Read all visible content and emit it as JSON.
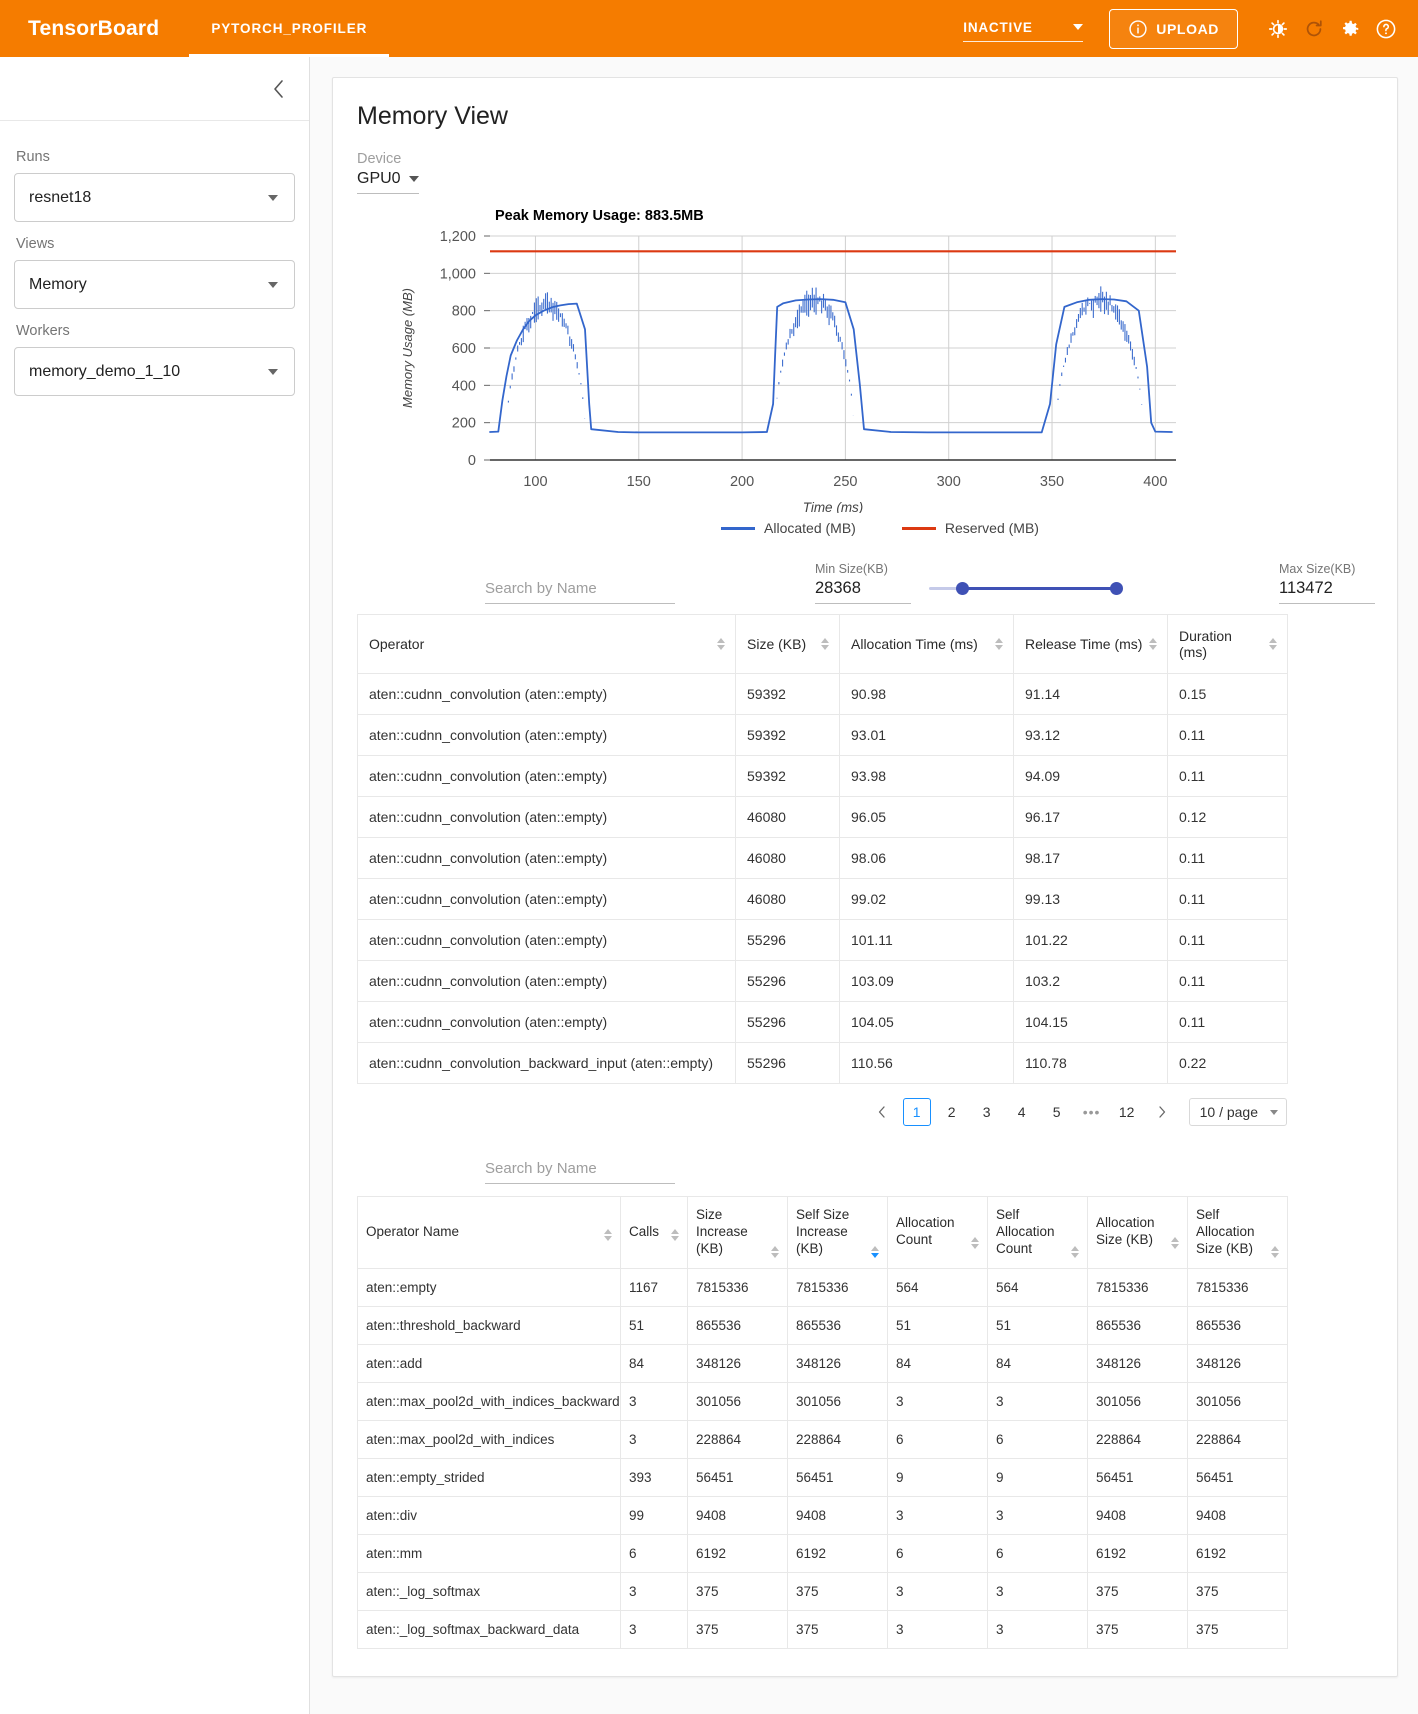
{
  "topbar": {
    "brand": "TensorBoard",
    "tab": "PYTORCH_PROFILER",
    "status_select": "INACTIVE",
    "upload_label": "UPLOAD",
    "icons": [
      "info-icon",
      "brightness-icon",
      "refresh-icon",
      "gear-icon",
      "help-icon"
    ],
    "accent": "#f57c00"
  },
  "sidebar": {
    "collapse_icon": "chevron-left-icon",
    "runs_label": "Runs",
    "runs_value": "resnet18",
    "views_label": "Views",
    "views_value": "Memory",
    "workers_label": "Workers",
    "workers_value": "memory_demo_1_10"
  },
  "main": {
    "title": "Memory View",
    "device_label": "Device",
    "device_value": "GPU0"
  },
  "chart_data": {
    "type": "line",
    "title": "Peak Memory Usage: 883.5MB",
    "xlabel": "Time (ms)",
    "ylabel": "Memory Usage (MB)",
    "xlim": [
      78,
      410
    ],
    "ylim": [
      0,
      1200
    ],
    "xticks": [
      100,
      150,
      200,
      250,
      300,
      350,
      400
    ],
    "yticks": [
      0,
      200,
      400,
      600,
      800,
      "1,000",
      "1,200"
    ],
    "grid": true,
    "legend_position": "bottom",
    "series": [
      {
        "name": "Allocated (MB)",
        "color": "#3366cc",
        "points": [
          [
            78,
            150
          ],
          [
            82,
            152
          ],
          [
            84,
            320
          ],
          [
            86,
            450
          ],
          [
            88,
            560
          ],
          [
            91,
            640
          ],
          [
            94,
            700
          ],
          [
            97,
            745
          ],
          [
            100,
            775
          ],
          [
            104,
            800
          ],
          [
            108,
            818
          ],
          [
            112,
            828
          ],
          [
            116,
            835
          ],
          [
            120,
            838
          ],
          [
            124,
            700
          ],
          [
            126,
            300
          ],
          [
            127,
            165
          ],
          [
            140,
            150
          ],
          [
            150,
            148
          ],
          [
            170,
            148
          ],
          [
            200,
            148
          ],
          [
            212,
            150
          ],
          [
            215,
            300
          ],
          [
            216,
            560
          ],
          [
            217,
            820
          ],
          [
            220,
            840
          ],
          [
            226,
            855
          ],
          [
            232,
            860
          ],
          [
            238,
            862
          ],
          [
            244,
            858
          ],
          [
            250,
            845
          ],
          [
            254,
            700
          ],
          [
            257,
            400
          ],
          [
            259,
            165
          ],
          [
            272,
            150
          ],
          [
            290,
            148
          ],
          [
            320,
            148
          ],
          [
            345,
            148
          ],
          [
            349,
            300
          ],
          [
            352,
            620
          ],
          [
            356,
            820
          ],
          [
            362,
            845
          ],
          [
            368,
            858
          ],
          [
            374,
            862
          ],
          [
            380,
            860
          ],
          [
            386,
            850
          ],
          [
            392,
            800
          ],
          [
            396,
            500
          ],
          [
            398,
            200
          ],
          [
            400,
            152
          ],
          [
            408,
            150
          ]
        ]
      },
      {
        "name": "Reserved (MB)",
        "color": "#dc3912",
        "constant": 1118
      }
    ]
  },
  "filters": {
    "search_placeholder": "Search by Name",
    "min_size_label": "Min Size(KB)",
    "min_size_value": "28368",
    "max_size_label": "Max Size(KB)",
    "max_size_value": "113472"
  },
  "table1": {
    "columns": [
      "Operator",
      "Size (KB)",
      "Allocation Time (ms)",
      "Release Time (ms)",
      "Duration (ms)"
    ],
    "rows": [
      [
        "aten::cudnn_convolution (aten::empty)",
        "59392",
        "90.98",
        "91.14",
        "0.15"
      ],
      [
        "aten::cudnn_convolution (aten::empty)",
        "59392",
        "93.01",
        "93.12",
        "0.11"
      ],
      [
        "aten::cudnn_convolution (aten::empty)",
        "59392",
        "93.98",
        "94.09",
        "0.11"
      ],
      [
        "aten::cudnn_convolution (aten::empty)",
        "46080",
        "96.05",
        "96.17",
        "0.12"
      ],
      [
        "aten::cudnn_convolution (aten::empty)",
        "46080",
        "98.06",
        "98.17",
        "0.11"
      ],
      [
        "aten::cudnn_convolution (aten::empty)",
        "46080",
        "99.02",
        "99.13",
        "0.11"
      ],
      [
        "aten::cudnn_convolution (aten::empty)",
        "55296",
        "101.11",
        "101.22",
        "0.11"
      ],
      [
        "aten::cudnn_convolution (aten::empty)",
        "55296",
        "103.09",
        "103.2",
        "0.11"
      ],
      [
        "aten::cudnn_convolution (aten::empty)",
        "55296",
        "104.05",
        "104.15",
        "0.11"
      ],
      [
        "aten::cudnn_convolution_backward_input (aten::empty)",
        "55296",
        "110.56",
        "110.78",
        "0.22"
      ]
    ]
  },
  "pagination": {
    "prev_icon": "chevron-left-icon",
    "next_icon": "chevron-right-icon",
    "pages": [
      "1",
      "2",
      "3",
      "4",
      "5"
    ],
    "ellipsis": "•••",
    "last_page": "12",
    "active_page": "1",
    "page_size": "10 / page"
  },
  "table2": {
    "search_placeholder": "Search by Name",
    "columns": [
      "Operator Name",
      "Calls",
      "Size Increase (KB)",
      "Self Size Increase (KB)",
      "Allocation Count",
      "Self Allocation Count",
      "Allocation Size (KB)",
      "Self Allocation Size (KB)"
    ],
    "rows": [
      [
        "aten::empty",
        "1167",
        "7815336",
        "7815336",
        "564",
        "564",
        "7815336",
        "7815336"
      ],
      [
        "aten::threshold_backward",
        "51",
        "865536",
        "865536",
        "51",
        "51",
        "865536",
        "865536"
      ],
      [
        "aten::add",
        "84",
        "348126",
        "348126",
        "84",
        "84",
        "348126",
        "348126"
      ],
      [
        "aten::max_pool2d_with_indices_backward",
        "3",
        "301056",
        "301056",
        "3",
        "3",
        "301056",
        "301056"
      ],
      [
        "aten::max_pool2d_with_indices",
        "3",
        "228864",
        "228864",
        "6",
        "6",
        "228864",
        "228864"
      ],
      [
        "aten::empty_strided",
        "393",
        "56451",
        "56451",
        "9",
        "9",
        "56451",
        "56451"
      ],
      [
        "aten::div",
        "99",
        "9408",
        "9408",
        "3",
        "3",
        "9408",
        "9408"
      ],
      [
        "aten::mm",
        "6",
        "6192",
        "6192",
        "6",
        "6",
        "6192",
        "6192"
      ],
      [
        "aten::_log_softmax",
        "3",
        "375",
        "375",
        "3",
        "3",
        "375",
        "375"
      ],
      [
        "aten::_log_softmax_backward_data",
        "3",
        "375",
        "375",
        "3",
        "3",
        "375",
        "375"
      ]
    ]
  }
}
